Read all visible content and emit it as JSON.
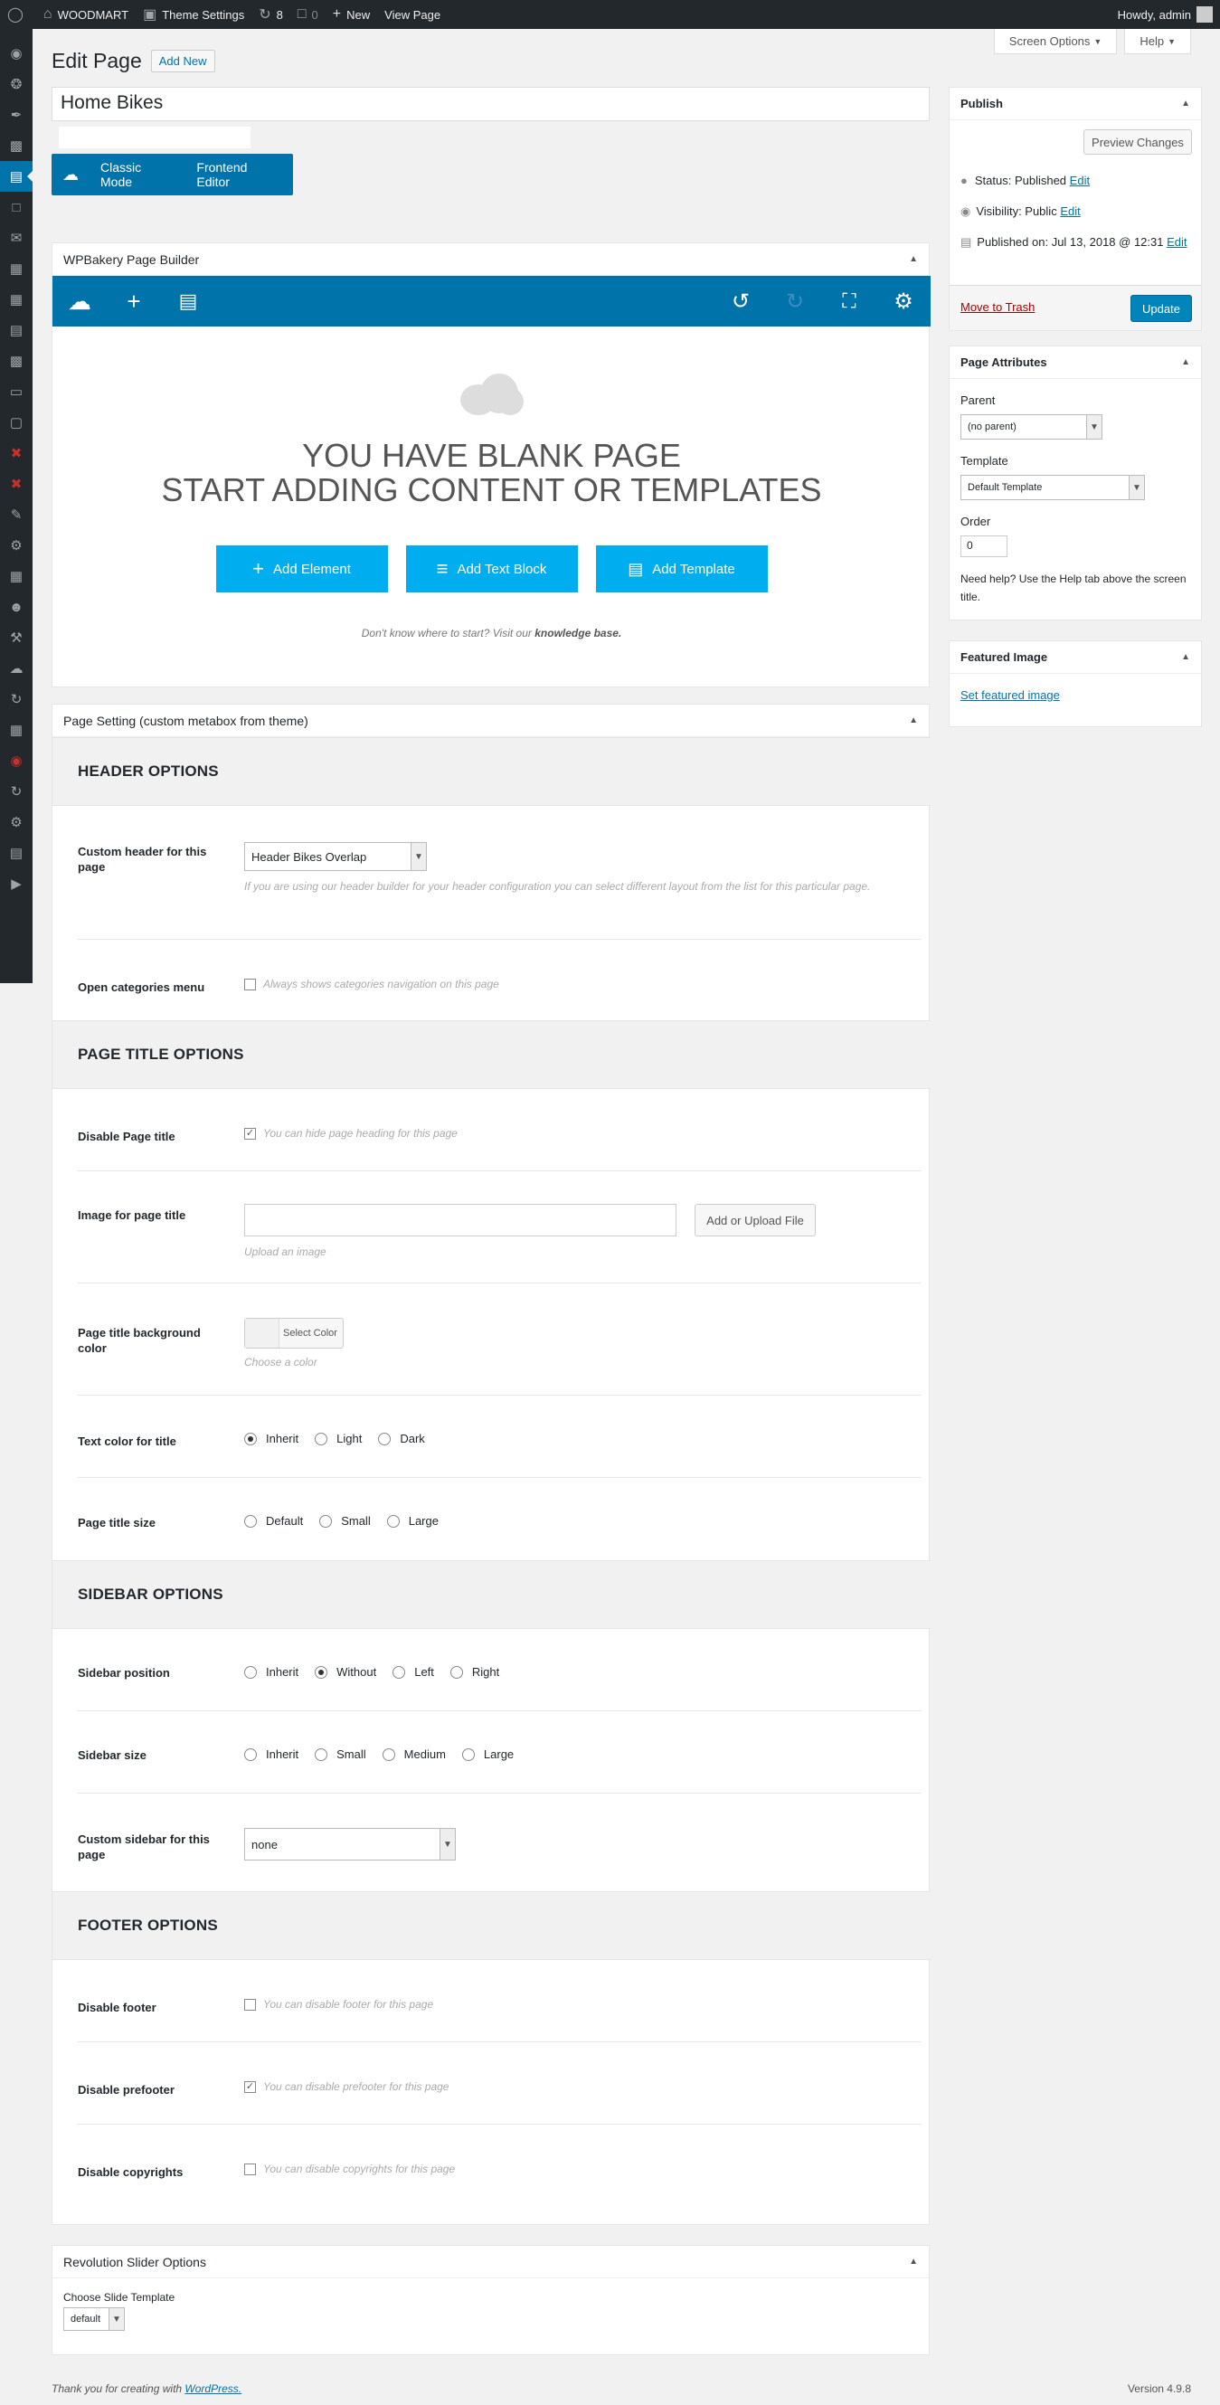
{
  "adminbar": {
    "site": "WOODMART",
    "theme_settings": "Theme Settings",
    "updates": "8",
    "comments": "0",
    "new": "New",
    "view_page": "View Page",
    "howdy": "Howdy, admin"
  },
  "screen_meta": {
    "screen_options": "Screen Options",
    "help": "Help"
  },
  "page": {
    "heading": "Edit Page",
    "add_new": "Add New",
    "title_value": "Home Bikes"
  },
  "modes": {
    "classic": "Classic Mode",
    "frontend": "Frontend Editor"
  },
  "wpbakery": {
    "title": "WPBakery Page Builder",
    "blank_line1": "YOU HAVE BLANK PAGE",
    "blank_line2": "START ADDING CONTENT OR TEMPLATES",
    "add_element": "Add Element",
    "add_text_block": "Add Text Block",
    "add_template": "Add Template",
    "kb_text": "Don't know where to start? Visit our",
    "kb_link": "knowledge base."
  },
  "page_setting": {
    "title": "Page Setting (custom metabox from theme)",
    "header_options": "HEADER OPTIONS",
    "custom_header_label": "Custom header for this page",
    "custom_header_value": "Header Bikes Overlap",
    "custom_header_hint": "If you are using our header builder for your header configuration you can select different layout from the list for this particular page.",
    "open_cat_label": "Open categories menu",
    "open_cat_hint": "Always shows categories navigation on this page",
    "page_title_options": "PAGE TITLE OPTIONS",
    "disable_title_label": "Disable Page title",
    "disable_title_hint": "You can hide page heading for this page",
    "image_title_label": "Image for page title",
    "upload_btn": "Add or Upload File",
    "upload_hint": "Upload an image",
    "bg_color_label": "Page title background color",
    "select_color": "Select Color",
    "choose_color": "Choose a color",
    "text_color_label": "Text color for title",
    "text_color_opts": [
      "Inherit",
      "Light",
      "Dark"
    ],
    "title_size_label": "Page title size",
    "title_size_opts": [
      "Default",
      "Small",
      "Large"
    ],
    "sidebar_options": "SIDEBAR OPTIONS",
    "sidebar_pos_label": "Sidebar position",
    "sidebar_pos_opts": [
      "Inherit",
      "Without",
      "Left",
      "Right"
    ],
    "sidebar_size_label": "Sidebar size",
    "sidebar_size_opts": [
      "Inherit",
      "Small",
      "Medium",
      "Large"
    ],
    "custom_sidebar_label": "Custom sidebar for this page",
    "custom_sidebar_value": "none",
    "footer_options": "FOOTER OPTIONS",
    "disable_footer_label": "Disable footer",
    "disable_footer_hint": "You can disable footer for this page",
    "disable_prefooter_label": "Disable prefooter",
    "disable_prefooter_hint": "You can disable prefooter for this page",
    "disable_copy_label": "Disable copyrights",
    "disable_copy_hint": "You can disable copyrights for this page"
  },
  "revslider": {
    "title": "Revolution Slider Options",
    "choose_label": "Choose Slide Template",
    "value": "default"
  },
  "publish": {
    "title": "Publish",
    "preview": "Preview Changes",
    "status": "Status: Published",
    "visibility": "Visibility: Public",
    "published_on": "Published on: Jul 13, 2018 @ 12:31",
    "edit": "Edit",
    "trash": "Move to Trash",
    "update": "Update"
  },
  "attributes": {
    "title": "Page Attributes",
    "parent_label": "Parent",
    "parent_value": "(no parent)",
    "template_label": "Template",
    "template_value": "Default Template",
    "order_label": "Order",
    "order_value": "0",
    "help": "Need help? Use the Help tab above the screen title."
  },
  "featured": {
    "title": "Featured Image",
    "link": "Set featured image"
  },
  "footer": {
    "thanks": "Thank you for creating with",
    "wp": "WordPress.",
    "version": "Version 4.9.8"
  },
  "colors": {
    "accent": "#0073aa",
    "vc_button": "#00aef0",
    "adminbar": "#23282d"
  }
}
